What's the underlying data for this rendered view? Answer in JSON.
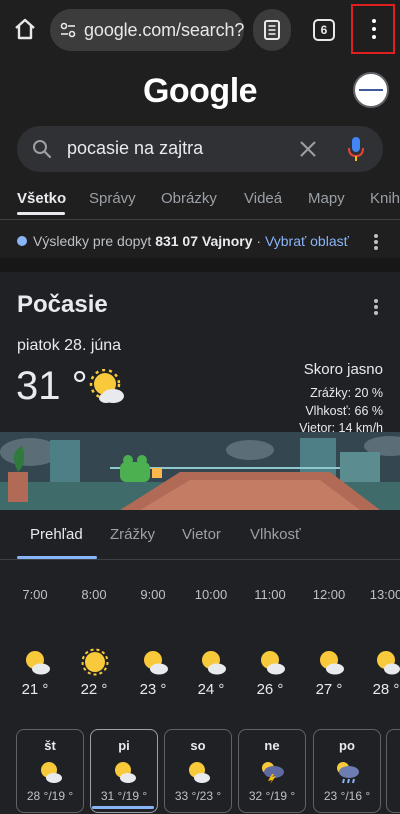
{
  "browser": {
    "url": "google.com/search?",
    "tab_count": "6"
  },
  "google": {
    "logo": "Google"
  },
  "search": {
    "query": "pocasie na zajtra"
  },
  "filters": [
    "Všetko",
    "Správy",
    "Obrázky",
    "Videá",
    "Mapy",
    "Knih"
  ],
  "location": {
    "prefix": "Výsledky pre dopyt",
    "place": "831 07 Vajnory",
    "separator": " · ",
    "link": "Vybrať oblasť"
  },
  "weather": {
    "title": "Počasie",
    "date": "piatok 28. júna",
    "temperature": "31 °",
    "condition": "Skoro jasno",
    "precipitation": "Zrážky: 20 %",
    "humidity": "Vlhkosť: 66 %",
    "wind": "Vietor: 14 km/h",
    "tabs": [
      "Prehľad",
      "Zrážky",
      "Vietor",
      "Vlhkosť"
    ],
    "hourly": [
      {
        "time": "7:00",
        "temp": "21 °",
        "icon": "partly-sunny-icon"
      },
      {
        "time": "8:00",
        "temp": "22 °",
        "icon": "sunny-icon"
      },
      {
        "time": "9:00",
        "temp": "23 °",
        "icon": "partly-sunny-icon"
      },
      {
        "time": "10:00",
        "temp": "24 °",
        "icon": "partly-sunny-icon"
      },
      {
        "time": "11:00",
        "temp": "26 °",
        "icon": "partly-sunny-icon"
      },
      {
        "time": "12:00",
        "temp": "27 °",
        "icon": "partly-sunny-icon"
      },
      {
        "time": "13:00",
        "temp": "28 °",
        "icon": "partly-sunny-icon"
      }
    ],
    "daily": [
      {
        "day": "št",
        "temps": "28 °/19 °",
        "icon": "partly-sunny-icon"
      },
      {
        "day": "pi",
        "temps": "31 °/19 °",
        "icon": "partly-sunny-icon"
      },
      {
        "day": "so",
        "temps": "33 °/23 °",
        "icon": "partly-sunny-icon"
      },
      {
        "day": "ne",
        "temps": "32 °/19 °",
        "icon": "thunderstorm-icon"
      },
      {
        "day": "po",
        "temps": "23 °/16 °",
        "icon": "rain-icon"
      }
    ]
  },
  "colors": {
    "background": "#1f1f1f",
    "accent_blue": "#8ab4f8",
    "highlight_red": "#e02020"
  }
}
